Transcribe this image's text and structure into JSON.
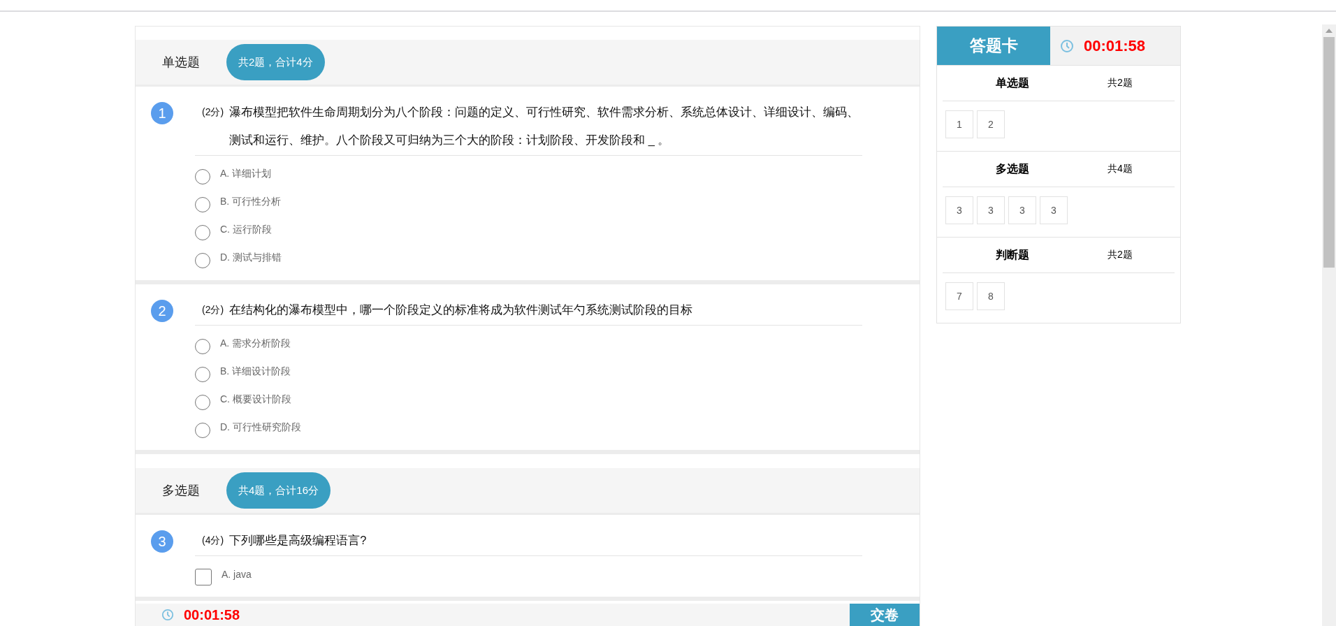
{
  "sections": [
    {
      "title": "单选题",
      "summary": "共2题，合计4分",
      "questions": [
        {
          "number": "1",
          "score": "(2分)",
          "kind": "single",
          "text": "瀑布模型把软件生命周期划分为八个阶段：问题的定义、可行性研究、软件需求分析、系统总体设计、详细设计、编码、测试和运行、维护。八个阶段又可归纳为三个大的阶段：计划阶段、开发阶段和 _ 。",
          "options": [
            {
              "label": "A. 详细计划",
              "selected": false
            },
            {
              "label": "B. 可行性分析",
              "selected": false
            },
            {
              "label": "C. 运行阶段",
              "selected": false
            },
            {
              "label": "D. 测试与排错",
              "selected": false
            }
          ]
        },
        {
          "number": "2",
          "score": "(2分)",
          "kind": "single",
          "text": "在结构化的瀑布模型中，哪一个阶段定义的标准将成为软件测试年勺系统测试阶段的目标",
          "options": [
            {
              "label": "A. 需求分析阶段",
              "selected": false
            },
            {
              "label": "B. 详细设计阶段",
              "selected": false
            },
            {
              "label": "C. 概要设计阶段",
              "selected": false
            },
            {
              "label": "D. 可行性研究阶段",
              "selected": false
            }
          ]
        }
      ]
    },
    {
      "title": "多选题",
      "summary": "共4题，合计16分",
      "questions": [
        {
          "number": "3",
          "score": "(4分)",
          "kind": "multiple",
          "text": "下列哪些是高级编程语言?",
          "options": [
            {
              "label": "A. java",
              "selected": false
            }
          ]
        }
      ]
    }
  ],
  "answer_card": {
    "title": "答题卡",
    "timer": "00:01:58",
    "groups": [
      {
        "title": "单选题",
        "count": "共2题",
        "numbers": [
          "1",
          "2"
        ]
      },
      {
        "title": "多选题",
        "count": "共4题",
        "numbers": [
          "3",
          "3",
          "3",
          "3"
        ]
      },
      {
        "title": "判断题",
        "count": "共2题",
        "numbers": [
          "7",
          "8"
        ]
      }
    ]
  },
  "footer": {
    "timer": "00:01:58",
    "submit": "交卷"
  }
}
